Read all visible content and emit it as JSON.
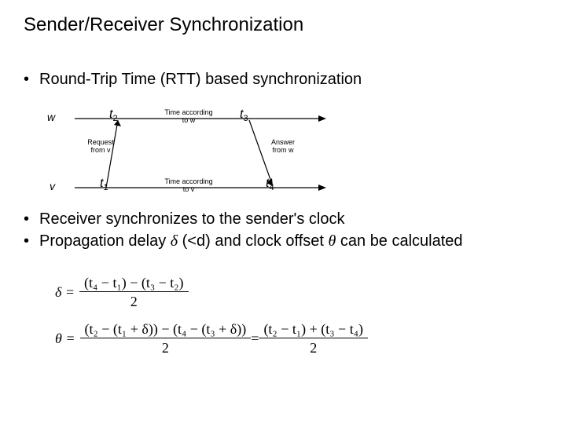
{
  "title": "Sender/Receiver Synchronization",
  "bullets": {
    "b1": "Round-Trip Time (RTT) based synchronization",
    "b2": "Receiver synchronizes to the sender's clock",
    "b3_pre": "Propagation delay ",
    "b3_delta": "δ",
    "b3_mid": "  (<d) and clock offset ",
    "b3_theta": "θ",
    "b3_post": " can be calculated"
  },
  "diagram": {
    "node_w": "w",
    "node_v": "v",
    "t1": "t",
    "t1_sub": "1",
    "t2": "t",
    "t2_sub": "2",
    "t3": "t",
    "t3_sub": "3",
    "t4": "t",
    "t4_sub": "4",
    "time_w": "Time according\nto w",
    "time_v": "Time according\nto v",
    "req": "Request\nfrom v",
    "ans": "Answer\nfrom w"
  },
  "equations": {
    "delta_lhs": "δ =",
    "delta_num": "(t₄ − t₁) − (t₃ − t₂)",
    "delta_den": "2",
    "theta_lhs": "θ =",
    "theta_num1": "(t₂ − (t₁ + δ)) − (t₄ − (t₃ + δ))",
    "theta_den1": "2",
    "theta_eq": " = ",
    "theta_num2": "(t₂ − t₁) + (t₃ − t₄)",
    "theta_den2": "2"
  }
}
